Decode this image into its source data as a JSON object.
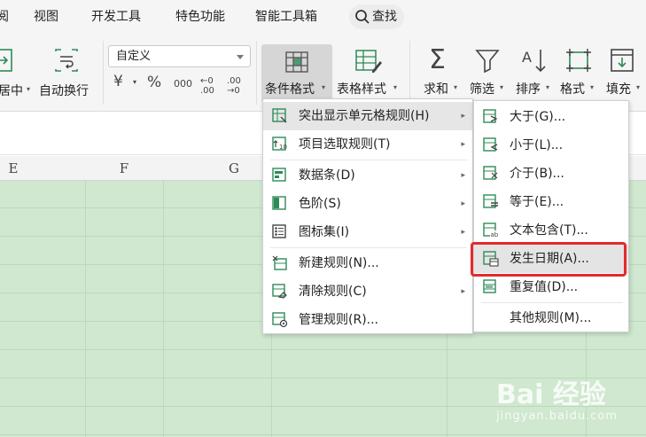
{
  "menubar": {
    "items": [
      "阅",
      "视图",
      "开发工具",
      "特色功能",
      "智能工具箱"
    ],
    "search_label": "查找"
  },
  "ribbon": {
    "merge_label": "居中",
    "wrap_label": "自动换行",
    "number_format_value": "自定义",
    "number_buttons": [
      "¥",
      "%",
      "000",
      "←0 .00",
      ".00 →0"
    ],
    "cond_format_label": "条件格式",
    "table_style_label": "表格样式",
    "sum_label": "求和",
    "filter_label": "筛选",
    "sort_label": "排序",
    "format_label": "格式",
    "fill_label": "填充"
  },
  "columns": [
    "E",
    "F",
    "G"
  ],
  "cond_menu": {
    "items": [
      {
        "label": "突出显示单元格规则(H)",
        "icon": "highlight-rules-icon",
        "submenu": true
      },
      {
        "label": "项目选取规则(T)",
        "icon": "top-bottom-rules-icon",
        "submenu": true
      },
      {
        "label": "数据条(D)",
        "icon": "data-bars-icon",
        "submenu": true
      },
      {
        "label": "色阶(S)",
        "icon": "color-scales-icon",
        "submenu": true
      },
      {
        "label": "图标集(I)",
        "icon": "icon-sets-icon",
        "submenu": true
      },
      {
        "label": "新建规则(N)...",
        "icon": "new-rule-icon",
        "submenu": false
      },
      {
        "label": "清除规则(C)",
        "icon": "clear-rules-icon",
        "submenu": true
      },
      {
        "label": "管理规则(R)...",
        "icon": "manage-rules-icon",
        "submenu": false
      }
    ]
  },
  "sub_menu": {
    "items": [
      {
        "label": "大于(G)...",
        "icon": "greater-than-icon"
      },
      {
        "label": "小于(L)...",
        "icon": "less-than-icon"
      },
      {
        "label": "介于(B)...",
        "icon": "between-icon"
      },
      {
        "label": "等于(E)...",
        "icon": "equal-to-icon"
      },
      {
        "label": "文本包含(T)...",
        "icon": "text-contains-icon"
      },
      {
        "label": "发生日期(A)...",
        "icon": "date-occurring-icon"
      },
      {
        "label": "重复值(D)...",
        "icon": "duplicate-values-icon"
      },
      {
        "label": "其他规则(M)...",
        "icon": ""
      }
    ]
  },
  "colors": {
    "accent_green": "#2e8b57",
    "highlight_red": "#e32b2b",
    "grid_green": "#cfe8cf"
  },
  "watermark": {
    "logo": "Bai 经验",
    "sub": "jingyan.baidu.com"
  }
}
